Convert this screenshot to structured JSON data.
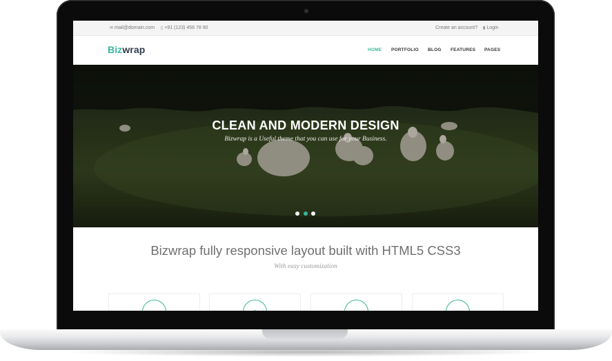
{
  "topbar": {
    "email": "mail@domain.com",
    "phone": "+91 (123) 456 78 90",
    "create_account": "Create an account?",
    "login": "Login"
  },
  "brand": {
    "logo_part1": "Biz",
    "logo_part2": "wrap"
  },
  "nav": {
    "items": [
      {
        "label": "HOME",
        "active": true
      },
      {
        "label": "PORTFOLIO",
        "active": false
      },
      {
        "label": "BLOG",
        "active": false
      },
      {
        "label": "FEATURES",
        "active": false
      },
      {
        "label": "PAGES",
        "active": false
      }
    ]
  },
  "hero": {
    "title": "CLEAN AND MODERN DESIGN",
    "subtitle": "Bizwrap is a Useful theme that you can use for your Business.",
    "slides": 3,
    "active_slide": 2
  },
  "section": {
    "title": "Bizwrap fully responsive layout built with HTML5 CSS3",
    "subtitle": "With easy customization"
  },
  "feature_cards": [
    {
      "icon": "monitor-icon"
    },
    {
      "icon": "mobile-icon"
    },
    {
      "icon": "twitter-icon"
    },
    {
      "icon": "plus-icon"
    }
  ],
  "colors": {
    "accent": "#38b59b",
    "brand_dark": "#2f3b4a"
  }
}
